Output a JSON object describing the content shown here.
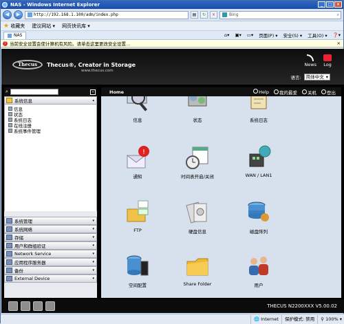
{
  "window": {
    "title": "NAS - Windows Internet Explorer"
  },
  "address": {
    "url": "http://192.168.1.100/adm/index.php",
    "search_placeholder": "Bing"
  },
  "favorites": {
    "label": "收藏夹",
    "items": [
      "建议网站 ▾",
      "网页快讯库 ▾"
    ]
  },
  "tab": {
    "label": "NAS"
  },
  "commandbar": {
    "items": [
      "页面(P) ▾",
      "安全(S) ▾",
      "工具(O) ▾",
      "❓▾"
    ]
  },
  "infobar": {
    "text": "当前安全设置会使计算机有风险。请单击这里更改安全设置..."
  },
  "header": {
    "brand": "Thecus",
    "slogan": "Thecus®, Creator in Storage",
    "site": "www.thecus.com",
    "news_label": "News",
    "log_label": "Log",
    "lang_label": "语言:",
    "lang_value": "简体中文"
  },
  "sidebar": {
    "categories_top": [
      {
        "label": "系统信息",
        "icon": "info-icon"
      }
    ],
    "items": [
      "信息",
      "状态",
      "系统日志",
      "在线注册",
      "系统事件管理"
    ],
    "categories_bottom": [
      {
        "label": "系统管理",
        "icon": "tools-icon"
      },
      {
        "label": "系统网络",
        "icon": "network-icon"
      },
      {
        "label": "存储",
        "icon": "storage-icon"
      },
      {
        "label": "用户和群组验证",
        "icon": "users-icon"
      },
      {
        "label": "Network Service",
        "icon": "service-icon"
      },
      {
        "label": "应用程序服务器",
        "icon": "app-icon"
      },
      {
        "label": "备份",
        "icon": "backup-icon"
      },
      {
        "label": "External Device",
        "icon": "device-icon"
      }
    ]
  },
  "main": {
    "title": "Home",
    "links": [
      "Help",
      "我的最爱",
      "关机",
      "登出"
    ],
    "tiles": [
      {
        "label": "信息",
        "icon": "info-magnifier-icon"
      },
      {
        "label": "状态",
        "icon": "status-icon"
      },
      {
        "label": "系统日志",
        "icon": "syslog-icon"
      },
      {
        "label": "通知",
        "icon": "notification-icon"
      },
      {
        "label": "时间表开启/关闭",
        "icon": "schedule-icon"
      },
      {
        "label": "WAN / LAN1",
        "icon": "network-globe-icon"
      },
      {
        "label": "FTP",
        "icon": "ftp-folder-icon"
      },
      {
        "label": "硬盘信息",
        "icon": "disk-icon"
      },
      {
        "label": "磁盘阵列",
        "icon": "raid-icon"
      },
      {
        "label": "空间配置",
        "icon": "space-alloc-icon"
      },
      {
        "label": "Share Folder",
        "icon": "share-folder-icon"
      },
      {
        "label": "用户",
        "icon": "users-icon"
      }
    ]
  },
  "footer": {
    "version": "THECUS N2200XXX V5.00.02"
  },
  "statusbar": {
    "zone": "Internet",
    "mode": "保护模式: 禁用",
    "zoom": "100%"
  }
}
